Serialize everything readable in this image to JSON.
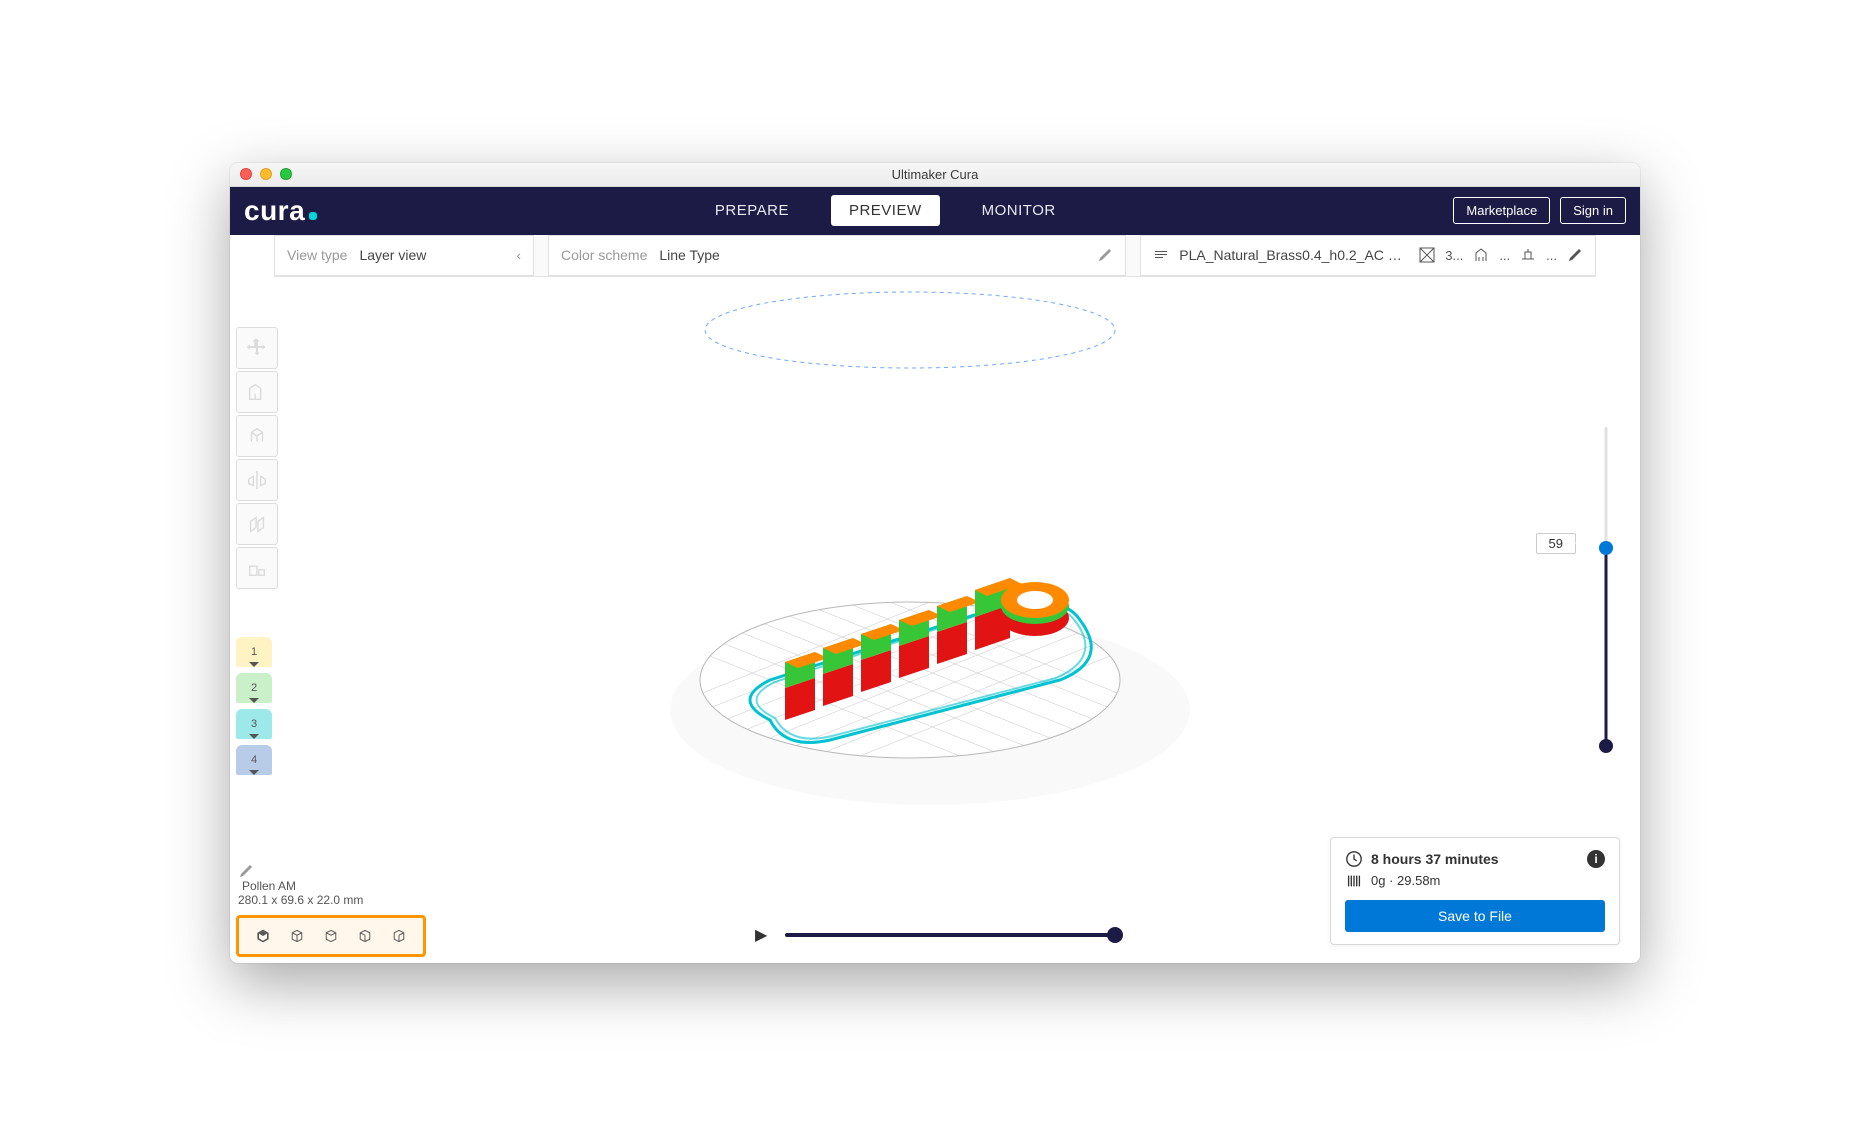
{
  "titlebar": {
    "title": "Ultimaker Cura"
  },
  "logo": "cura",
  "nav": {
    "prepare": "PREPARE",
    "preview": "PREVIEW",
    "monitor": "MONITOR",
    "marketplace": "Marketplace",
    "signin": "Sign in",
    "active": "preview"
  },
  "subbar": {
    "view_type_label": "View type",
    "view_type_value": "Layer view",
    "color_scheme_label": "Color scheme",
    "color_scheme_value": "Line Type",
    "profile_name": "PLA_Natural_Brass0.4_h0.2_AC 0....",
    "infill_pct": "3...",
    "ext_badges": "..."
  },
  "tools": [
    {
      "name": "move-tool"
    },
    {
      "name": "scale-tool"
    },
    {
      "name": "rotate-tool"
    },
    {
      "name": "mirror-tool"
    },
    {
      "name": "per-model-tool"
    },
    {
      "name": "support-blocker-tool"
    }
  ],
  "extruders": [
    {
      "n": "1",
      "color": "#fff3c4"
    },
    {
      "n": "2",
      "color": "#c9f0c9"
    },
    {
      "n": "3",
      "color": "#9de8e8"
    },
    {
      "n": "4",
      "color": "#b8cce8"
    }
  ],
  "model": {
    "name": "Pollen AM",
    "dims": "280.1 x 69.6 x 22.0 mm"
  },
  "layer": {
    "current": "59"
  },
  "print": {
    "time": "8 hours 37 minutes",
    "material": "0g · 29.58m",
    "save": "Save to File"
  },
  "colors": {
    "navy": "#1b1b46",
    "teal": "#00d9d9",
    "blue": "#0078d7",
    "orange": "#ff9500"
  }
}
